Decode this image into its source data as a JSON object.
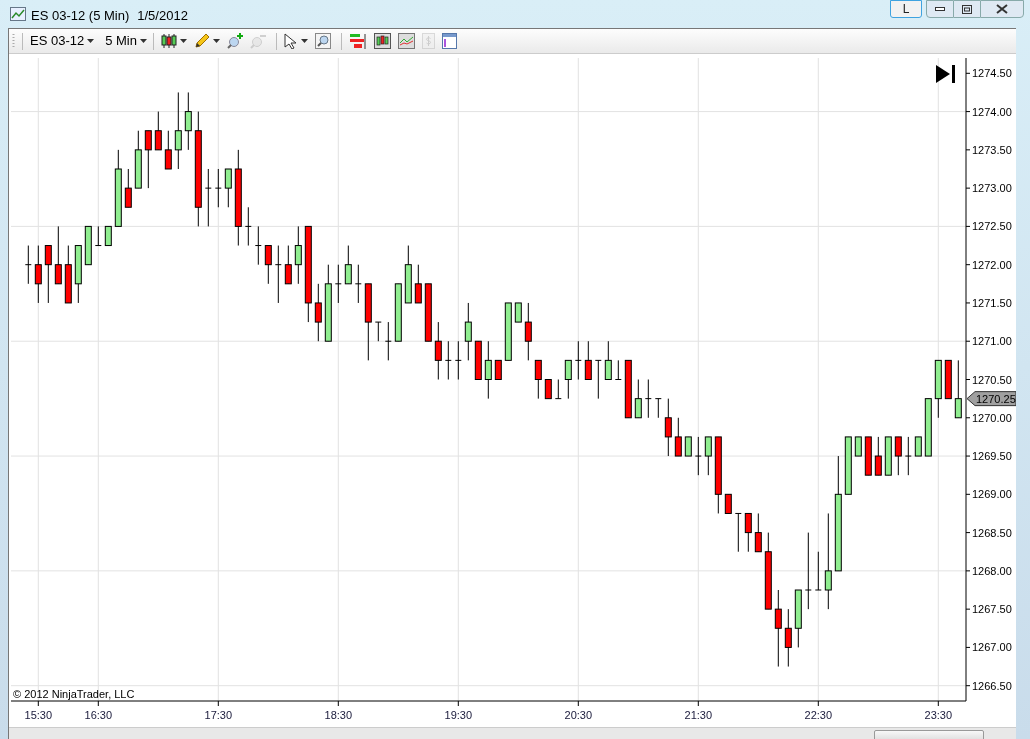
{
  "window": {
    "title": "ES 03-12 (5 Min)",
    "date": "1/5/2012",
    "caption_buttons": [
      {
        "kind": "text",
        "label": "L"
      },
      {
        "kind": "minimize"
      },
      {
        "kind": "maximize"
      },
      {
        "kind": "close"
      }
    ]
  },
  "toolbar": {
    "instrument": "ES 03-12",
    "interval": "5 Min",
    "tool_groups": [
      {
        "tools": [
          {
            "kind": "candles",
            "dropdown": true,
            "disabled": false
          },
          {
            "kind": "pencil",
            "dropdown": true,
            "disabled": false
          },
          {
            "kind": "zoom-in",
            "dropdown": false,
            "disabled": false
          },
          {
            "kind": "zoom-out",
            "dropdown": false,
            "disabled": true
          }
        ]
      },
      {
        "tools": [
          {
            "kind": "pointer",
            "dropdown": true,
            "disabled": false
          },
          {
            "kind": "zoom-box",
            "dropdown": false,
            "disabled": false
          }
        ]
      },
      {
        "tools": [
          {
            "kind": "bars",
            "dropdown": false,
            "disabled": false
          },
          {
            "kind": "candle-box",
            "dropdown": false,
            "disabled": false
          },
          {
            "kind": "line-box",
            "dropdown": false,
            "disabled": false
          },
          {
            "kind": "dollar-doc",
            "dropdown": false,
            "disabled": true
          },
          {
            "kind": "panel",
            "dropdown": false,
            "disabled": false
          }
        ]
      }
    ]
  },
  "chart": {
    "copyright": "© 2012 NinjaTrader, LLC",
    "price_marker": "1270.25",
    "chart_data": {
      "type": "candlestick",
      "grid": true,
      "categories": [
        null,
        "15:30",
        null,
        null,
        null,
        null,
        null,
        "16:30",
        null,
        null,
        null,
        null,
        null,
        null,
        null,
        null,
        null,
        null,
        null,
        "17:30",
        null,
        null,
        null,
        null,
        null,
        null,
        null,
        null,
        null,
        null,
        null,
        "18:30",
        null,
        null,
        null,
        null,
        null,
        null,
        null,
        null,
        null,
        null,
        null,
        "19:30",
        null,
        null,
        null,
        null,
        null,
        null,
        null,
        null,
        null,
        null,
        null,
        "20:30",
        null,
        null,
        null,
        null,
        null,
        null,
        null,
        null,
        null,
        null,
        null,
        "21:30",
        null,
        null,
        null,
        null,
        null,
        null,
        null,
        null,
        null,
        null,
        null,
        "22:30",
        null,
        null,
        null,
        null,
        null,
        null,
        null,
        null,
        null,
        null,
        null,
        "23:30",
        null,
        null
      ],
      "ohlc": [
        [
          1272,
          1272.25,
          1271.75,
          1272
        ],
        [
          1272,
          1272.25,
          1271.5,
          1271.75
        ],
        [
          1272.25,
          1272.25,
          1271.5,
          1272
        ],
        [
          1272,
          1272.5,
          1271.75,
          1271.75
        ],
        [
          1272,
          1272.25,
          1271.5,
          1271.5
        ],
        [
          1271.75,
          1272.25,
          1271.5,
          1272.25
        ],
        [
          1272,
          1272.5,
          1272,
          1272.5
        ],
        [
          1272.25,
          1272.5,
          1272.25,
          1272.25
        ],
        [
          1272.25,
          1272.5,
          1272.25,
          1272.5
        ],
        [
          1272.5,
          1273.5,
          1272.5,
          1273.25
        ],
        [
          1273,
          1273.25,
          1272.75,
          1272.75
        ],
        [
          1273,
          1273.75,
          1273,
          1273.5
        ],
        [
          1273.75,
          1273.75,
          1273,
          1273.5
        ],
        [
          1273.75,
          1274,
          1273.5,
          1273.5
        ],
        [
          1273.5,
          1273.75,
          1273.25,
          1273.25
        ],
        [
          1273.5,
          1274.25,
          1273.25,
          1273.75
        ],
        [
          1273.75,
          1274.25,
          1273.5,
          1274
        ],
        [
          1273.75,
          1274,
          1272.5,
          1272.75
        ],
        [
          1273,
          1273.25,
          1272.5,
          1273
        ],
        [
          1273,
          1273.25,
          1272.75,
          1273
        ],
        [
          1273,
          1273.25,
          1272.75,
          1273.25
        ],
        [
          1273.25,
          1273.5,
          1272.25,
          1272.5
        ],
        [
          1272.5,
          1272.75,
          1272.25,
          1272.5
        ],
        [
          1272.25,
          1272.5,
          1272,
          1272.25
        ],
        [
          1272.25,
          1272.25,
          1271.75,
          1272
        ],
        [
          1272,
          1272.25,
          1271.5,
          1272
        ],
        [
          1272,
          1272.25,
          1271.75,
          1271.75
        ],
        [
          1272,
          1272.5,
          1271.75,
          1272.25
        ],
        [
          1272.5,
          1272.5,
          1271.25,
          1271.5
        ],
        [
          1271.5,
          1271.75,
          1271,
          1271.25
        ],
        [
          1271,
          1272,
          1271,
          1271.75
        ],
        [
          1271.75,
          1272,
          1271.5,
          1271.75
        ],
        [
          1271.75,
          1272.25,
          1271.75,
          1272
        ],
        [
          1271.75,
          1272,
          1271.5,
          1271.75
        ],
        [
          1271.75,
          1271.75,
          1270.75,
          1271.25
        ],
        [
          1271.25,
          1271.25,
          1271,
          1271.25
        ],
        [
          1271,
          1271.25,
          1270.75,
          1271
        ],
        [
          1271,
          1271.75,
          1271,
          1271.75
        ],
        [
          1271.5,
          1272.25,
          1271.5,
          1272
        ],
        [
          1271.75,
          1272,
          1271.5,
          1271.5
        ],
        [
          1271.75,
          1271.75,
          1271,
          1271
        ],
        [
          1271,
          1271.25,
          1270.5,
          1270.75
        ],
        [
          1270.75,
          1271,
          1270.5,
          1270.75
        ],
        [
          1270.75,
          1271,
          1270.5,
          1270.75
        ],
        [
          1271,
          1271.5,
          1270.75,
          1271.25
        ],
        [
          1271,
          1271,
          1270.5,
          1270.5
        ],
        [
          1270.5,
          1271,
          1270.25,
          1270.75
        ],
        [
          1270.75,
          1270.75,
          1270.5,
          1270.5
        ],
        [
          1270.75,
          1271.5,
          1270.75,
          1271.5
        ],
        [
          1271.25,
          1271.5,
          1271.25,
          1271.5
        ],
        [
          1271.25,
          1271.5,
          1270.75,
          1271
        ],
        [
          1270.75,
          1270.75,
          1270.25,
          1270.5
        ],
        [
          1270.5,
          1270.5,
          1270.25,
          1270.25
        ],
        [
          1270.25,
          1270.5,
          1270.25,
          1270.25
        ],
        [
          1270.5,
          1270.75,
          1270.25,
          1270.75
        ],
        [
          1270.75,
          1271,
          1270.5,
          1270.75
        ],
        [
          1270.75,
          1271,
          1270.5,
          1270.5
        ],
        [
          1270.75,
          1270.75,
          1270.25,
          1270.75
        ],
        [
          1270.5,
          1271,
          1270.5,
          1270.75
        ],
        [
          1270.5,
          1270.75,
          1270.5,
          1270.5
        ],
        [
          1270.75,
          1270.75,
          1270,
          1270
        ],
        [
          1270,
          1270.5,
          1270,
          1270.25
        ],
        [
          1270.25,
          1270.5,
          1270,
          1270.25
        ],
        [
          1270.25,
          1270.25,
          1270,
          1270.25
        ],
        [
          1270,
          1270.25,
          1269.5,
          1269.75
        ],
        [
          1269.75,
          1270,
          1269.5,
          1269.5
        ],
        [
          1269.5,
          1269.75,
          1269.5,
          1269.75
        ],
        [
          1269.5,
          1269.75,
          1269.25,
          1269.5
        ],
        [
          1269.5,
          1269.75,
          1269.25,
          1269.75
        ],
        [
          1269.75,
          1269.75,
          1268.75,
          1269
        ],
        [
          1269,
          1269,
          1268.75,
          1268.75
        ],
        [
          1268.75,
          1268.75,
          1268.25,
          1268.75
        ],
        [
          1268.75,
          1268.75,
          1268.25,
          1268.5
        ],
        [
          1268.5,
          1268.75,
          1268.25,
          1268.25
        ],
        [
          1268.25,
          1268.5,
          1267.5,
          1267.5
        ],
        [
          1267.5,
          1267.75,
          1266.75,
          1267.25
        ],
        [
          1267.25,
          1267.5,
          1266.75,
          1267
        ],
        [
          1267.25,
          1267.75,
          1267,
          1267.75
        ],
        [
          1267.75,
          1268.5,
          1267.5,
          1267.75
        ],
        [
          1267.75,
          1268.25,
          1267.75,
          1267.75
        ],
        [
          1267.75,
          1268.75,
          1267.5,
          1268
        ],
        [
          1268,
          1269.5,
          1268,
          1269
        ],
        [
          1269,
          1269.75,
          1269,
          1269.75
        ],
        [
          1269.5,
          1269.75,
          1269.5,
          1269.75
        ],
        [
          1269.75,
          1269.75,
          1269.25,
          1269.25
        ],
        [
          1269.5,
          1269.75,
          1269.25,
          1269.25
        ],
        [
          1269.25,
          1269.75,
          1269.25,
          1269.75
        ],
        [
          1269.75,
          1269.75,
          1269.25,
          1269.5
        ],
        [
          1269.5,
          1269.75,
          1269.25,
          1269.5
        ],
        [
          1269.5,
          1269.75,
          1269.5,
          1269.75
        ],
        [
          1269.5,
          1270.25,
          1269.5,
          1270.25
        ],
        [
          1270.25,
          1270.75,
          1270,
          1270.75
        ],
        [
          1270.75,
          1270.75,
          1270.25,
          1270.25
        ],
        [
          1270,
          1270.75,
          1270,
          1270.25
        ]
      ],
      "ylim": [
        1266.3,
        1274.7
      ],
      "yticks": [
        {
          "value": 1274.5,
          "label": "1274.50"
        },
        {
          "value": 1274,
          "label": "1274.00"
        },
        {
          "value": 1273.5,
          "label": "1273.50"
        },
        {
          "value": 1273,
          "label": "1273.00"
        },
        {
          "value": 1272.5,
          "label": "1272.50"
        },
        {
          "value": 1272,
          "label": "1272.00"
        },
        {
          "value": 1271.5,
          "label": "1271.50"
        },
        {
          "value": 1271,
          "label": "1271.00"
        },
        {
          "value": 1270.5,
          "label": "1270.50"
        },
        {
          "value": 1270,
          "label": "1270.00"
        },
        {
          "value": 1269.5,
          "label": "1269.50"
        },
        {
          "value": 1269,
          "label": "1269.00"
        },
        {
          "value": 1268.5,
          "label": "1268.50"
        },
        {
          "value": 1268,
          "label": "1268.00"
        },
        {
          "value": 1267.5,
          "label": "1267.50"
        },
        {
          "value": 1267,
          "label": "1267.00"
        },
        {
          "value": 1266.5,
          "label": "1266.50"
        }
      ]
    }
  }
}
